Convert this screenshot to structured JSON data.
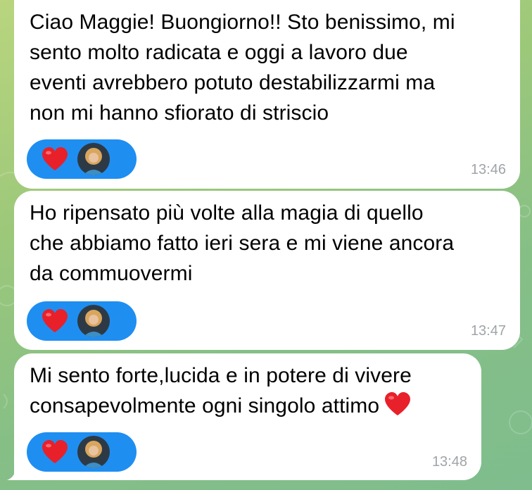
{
  "colors": {
    "bubble": "#ffffff",
    "reaction_pill": "#1f8ef1",
    "heart": "#e8202a",
    "timestamp": "#a0a4a8"
  },
  "messages": [
    {
      "text": "Ciao Maggie! Buongiorno!! Sto benissimo, mi\nsento molto radicata e oggi a lavoro due\neventi avrebbero potuto destabilizzarmi ma\nnon mi hanno sfiorato di striscio",
      "reaction": "heart",
      "time": "13:46"
    },
    {
      "text": "Ho ripensato più volte alla magia di quello\nche abbiamo fatto ieri sera e mi viene ancora\nda commuovermi",
      "reaction": "heart",
      "time": "13:47"
    },
    {
      "text": "Mi sento forte,lucida e in potere di vivere\nconsapevolmente ogni singolo attimo",
      "text_emoji": "heart",
      "reaction": "heart",
      "time": "13:48"
    }
  ]
}
